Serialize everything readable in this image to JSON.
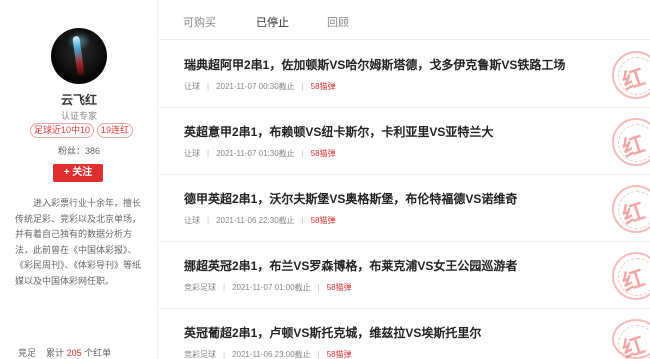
{
  "profile": {
    "name": "云飞红",
    "level": "认证专家",
    "tags": [
      "足球近10中10",
      "19连红"
    ],
    "fans": "粉丝：386",
    "follow_label": "+ 关注",
    "bio": "进入彩票行业十余年，擅长传统足彩、竞彩以及北京单场，并有着自己独有的数据分析方法，此前曾在《中国体彩报》、《彩民周刊》、《体彩导刊》等纸媒以及中国体彩网任职。",
    "stat_prefix": "竞足",
    "stat_mid": "累计",
    "stat_count": "205",
    "stat_suffix": "个红单"
  },
  "tabs": [
    "可购买",
    "已停止",
    "回顾"
  ],
  "active_tab": 1,
  "articles": [
    {
      "title": "瑞典超阿甲2串1，佐加顿斯VS哈尔姆斯塔德，戈多伊克鲁斯VS铁路工场",
      "category": "让球",
      "time": "2021-11-07 00:30截止",
      "price": "58猫弹"
    },
    {
      "title": "英超意甲2串1，布赖顿VS纽卡斯尔，卡利亚里VS亚特兰大",
      "category": "让球",
      "time": "2021-11-07 01:30截止",
      "price": "58猫弹"
    },
    {
      "title": "德甲英超2串1，沃尔夫斯堡VS奥格斯堡，布伦特福德VS诺维奇",
      "category": "让球",
      "time": "2021-11-06 22:30截止",
      "price": "58猫弹"
    },
    {
      "title": "挪超英冠2串1，布兰VS罗森博格，布莱克浦VS女王公园巡游者",
      "category": "竞彩足球",
      "time": "2021-11-07 01:00截止",
      "price": "58猫弹"
    },
    {
      "title": "英冠葡超2串1，卢顿VS斯托克城，维兹拉VS埃斯托里尔",
      "category": "竞彩足球",
      "time": "2021-11-06 23:00截止",
      "price": "58猫弹"
    }
  ],
  "stamp_text": "红",
  "colors": {
    "accent": "#e02f2f",
    "stamp": "#e03c3c"
  }
}
